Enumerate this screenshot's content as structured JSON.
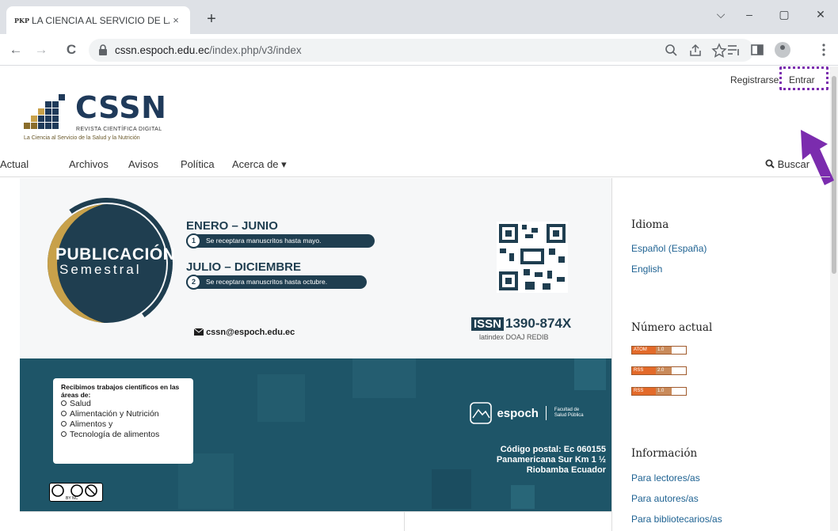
{
  "browser": {
    "tab_title": "LA CIENCIA AL SERVICIO DE LA",
    "tab_favicon": "PKP",
    "url_host": "cssn.espoch.edu.ec",
    "url_path": "/index.php/v3/index",
    "new_tab": "+",
    "tab_close": "×",
    "minimize": "–",
    "restore": "▢",
    "close": "✕",
    "chevron": "⌵",
    "back": "←",
    "forward": "→",
    "reload": "C"
  },
  "header": {
    "register": "Registrarse",
    "login": "Entrar",
    "logo_title": "CSSN",
    "logo_sub1": "REVISTA CIENTÍFICA DIGITAL",
    "logo_sub2": "La Ciencia al Servicio de la Salud y la Nutrición",
    "annotation_color": "#7b2cae"
  },
  "nav": {
    "items": [
      "Actual",
      "Archivos",
      "Avisos",
      "Política",
      "Acerca de ▾"
    ],
    "search": "Buscar"
  },
  "banner": {
    "pub_title": "PUBLICACIÓN",
    "pub_sub": "Semestral",
    "period1": "ENERO – JUNIO",
    "period1_num": "1",
    "period1_text": "Se receptara manuscritos hasta mayo.",
    "period2": "JULIO – DICIEMBRE",
    "period2_num": "2",
    "period2_text": "Se receptara manuscritos hasta octubre.",
    "email": "cssn@espoch.edu.ec",
    "issn_badge": "ISSN",
    "issn_code": "1390-874X",
    "indexers": "latindex   DOAJ   REDIB",
    "areas_head": "Recibimos trabajos científicos en las áreas de:",
    "areas": [
      "Salud",
      "Alimentación y Nutrición",
      "Alimentos y",
      "Tecnología de alimentos"
    ],
    "espoch": "espoch",
    "faculty": "Facultad de Salud Pública",
    "postal1": "Código postal: Ec 060155",
    "postal2": "Panamericana Sur Km 1 ½",
    "postal3": "Riobamba Ecuador",
    "cc_label": "BY   NC"
  },
  "sidebar": {
    "lang_heading": "Idioma",
    "lang1": "Español (España)",
    "lang2": "English",
    "issue_heading": "Número actual",
    "feeds": [
      {
        "a": "ATOM",
        "b": "1.0"
      },
      {
        "a": "RSS",
        "b": "2.0"
      },
      {
        "a": "RSS",
        "b": "1.0"
      }
    ],
    "info_heading": "Información",
    "info1": "Para lectores/as",
    "info2": "Para autores/as",
    "info3": "Para bibliotecarios/as"
  }
}
